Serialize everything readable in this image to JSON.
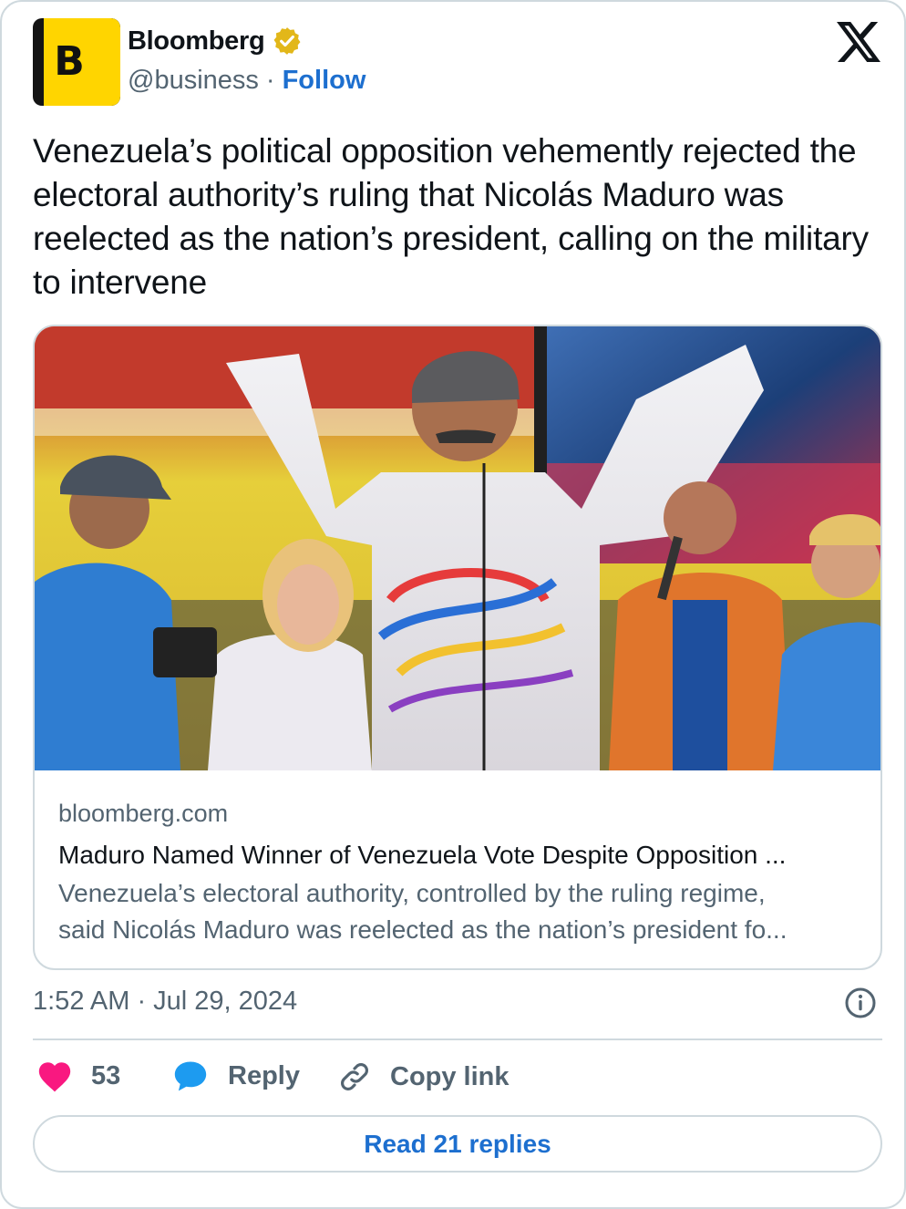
{
  "author": {
    "name": "Bloomberg",
    "handle": "@business",
    "separator": "·",
    "follow_label": "Follow",
    "avatar_letter": "B",
    "avatar_color": "#ffd500",
    "verified_icon": "verified-badge-icon",
    "verified_color": "#e2b719"
  },
  "platform_icon": "x-logo-icon",
  "tweet": {
    "text": "Venezuela’s political opposition vehemently rejected the electoral authority’s ruling that Nicolás Maduro was reelected as the nation’s president, calling on the military to intervene"
  },
  "link_card": {
    "domain": "bloomberg.com",
    "title": "Maduro Named Winner of Venezuela Vote Despite Opposition ...",
    "description_line1": "Venezuela’s electoral authority, controlled by the ruling regime,",
    "description_line2": "said Nicolás Maduro was reelected as the nation’s president fo..."
  },
  "timestamp": "1:52 AM · Jul 29, 2024",
  "actions": {
    "like_count": "53",
    "reply_label": "Reply",
    "copy_link_label": "Copy link"
  },
  "read_replies_label": "Read 21 replies",
  "colors": {
    "accent": "#1d6fcf",
    "like": "#f91880",
    "reply_icon": "#1d9bf0",
    "border": "#cfd9de",
    "secondary_text": "#536471"
  }
}
